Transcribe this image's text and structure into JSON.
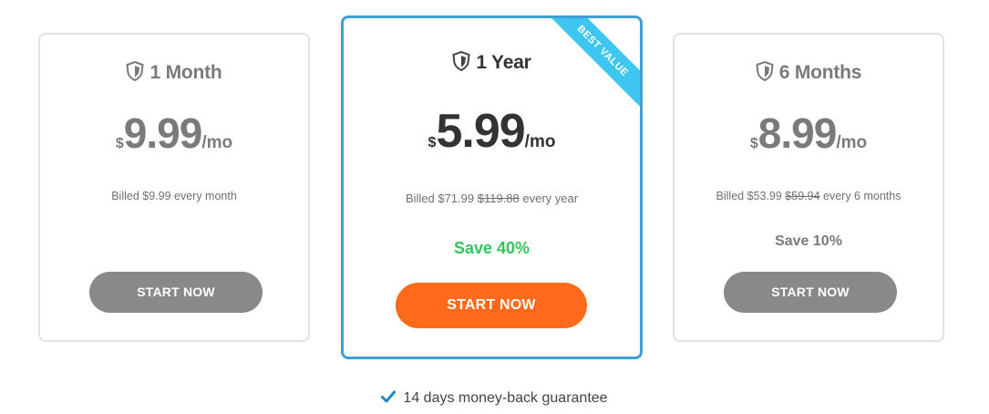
{
  "plans": [
    {
      "title": "1 Month",
      "currency": "$",
      "amount": "9.99",
      "period": "/mo",
      "billed_prefix": "Billed $9.99 every month",
      "billed_strike": "",
      "billed_suffix": "",
      "save": "",
      "cta": "START NOW",
      "featured": false
    },
    {
      "title": "1 Year",
      "currency": "$",
      "amount": "5.99",
      "period": "/mo",
      "billed_prefix": "Billed $71.99 ",
      "billed_strike": "$119.88",
      "billed_suffix": " every year",
      "save": "Save 40%",
      "cta": "START NOW",
      "featured": true,
      "ribbon": "BEST VALUE"
    },
    {
      "title": "6 Months",
      "currency": "$",
      "amount": "8.99",
      "period": "/mo",
      "billed_prefix": "Billed $53.99 ",
      "billed_strike": "$59.94",
      "billed_suffix": " every 6 months",
      "save": "Save 10%",
      "cta": "START NOW",
      "featured": false
    }
  ],
  "guarantee": "14 days money-back guarantee",
  "icons": {
    "plan": "shield-icon",
    "guarantee": "checkmark-icon"
  },
  "colors": {
    "featured_border": "#3fa0d6",
    "ribbon": "#3ec6f0",
    "cta_featured": "#ff6b1a",
    "cta_default": "#898989",
    "save_featured": "#33c45c",
    "check": "#1e88c9"
  }
}
